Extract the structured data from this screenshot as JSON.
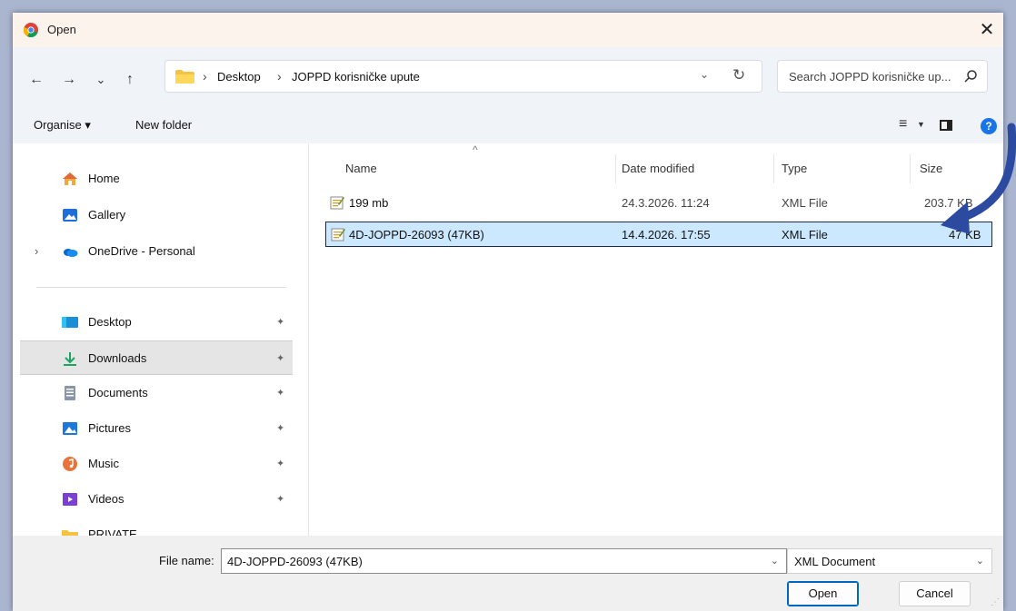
{
  "title": "Open",
  "close_glyph": "✕",
  "nav": {
    "back": "←",
    "forward": "→",
    "recent": "⌄",
    "up": "↑",
    "breadcrumbs": [
      "Desktop",
      "JOPPD korisničke upute"
    ],
    "sep": "›",
    "dropdown": "⌄",
    "refresh": "↻",
    "search_placeholder": "Search JOPPD korisničke up..."
  },
  "toolbar": {
    "organise": "Organise ▾",
    "new_folder": "New folder",
    "view_icon": "≡",
    "view_dd": "▼",
    "help": "?"
  },
  "sidebar": {
    "items": [
      {
        "label": "Home",
        "icon": "home-icon",
        "pin": "",
        "chev": ""
      },
      {
        "label": "Gallery",
        "icon": "gallery-icon",
        "pin": "",
        "chev": ""
      },
      {
        "label": "OneDrive - Personal",
        "icon": "onedrive-icon",
        "pin": "",
        "chev": "›"
      },
      {
        "label": "Desktop",
        "icon": "desktop-icon",
        "pin": "📌",
        "chev": ""
      },
      {
        "label": "Downloads",
        "icon": "downloads-icon",
        "pin": "📌",
        "chev": ""
      },
      {
        "label": "Documents",
        "icon": "documents-icon",
        "pin": "📌",
        "chev": ""
      },
      {
        "label": "Pictures",
        "icon": "pictures-icon",
        "pin": "📌",
        "chev": ""
      },
      {
        "label": "Music",
        "icon": "music-icon",
        "pin": "📌",
        "chev": ""
      },
      {
        "label": "Videos",
        "icon": "videos-icon",
        "pin": "📌",
        "chev": ""
      },
      {
        "label": "PRIVATE",
        "icon": "folder-icon",
        "pin": "",
        "chev": ""
      }
    ]
  },
  "columns": {
    "name": "Name",
    "date": "Date modified",
    "type": "Type",
    "size": "Size",
    "sort_glyph": "^"
  },
  "files": [
    {
      "name": "199 mb",
      "date": "24.3.2026. 11:24",
      "type": "XML File",
      "size": "203.7 KB"
    },
    {
      "name": "4D-JOPPD-26093 (47KB)",
      "date": "14.4.2026. 17:55",
      "type": "XML File",
      "size": "47 KB"
    }
  ],
  "bottom": {
    "file_name_label": "File name:",
    "file_name_value": "4D-JOPPD-26093 (47KB)",
    "file_type": "XML Document",
    "open": "Open",
    "cancel": "Cancel",
    "dd": "⌄"
  },
  "colors": {
    "accent": "#0067c0",
    "selection": "#cce8ff",
    "arrow": "#2b4aa0"
  }
}
